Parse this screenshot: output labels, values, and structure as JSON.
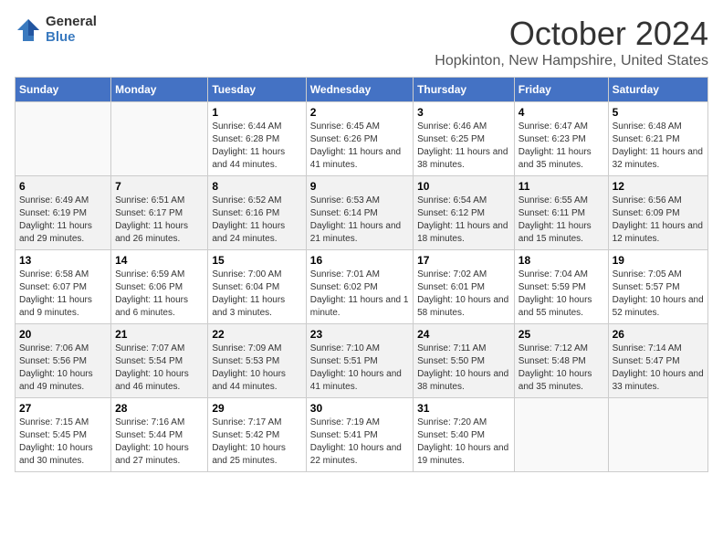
{
  "header": {
    "logo_general": "General",
    "logo_blue": "Blue",
    "month_title": "October 2024",
    "location": "Hopkinton, New Hampshire, United States"
  },
  "weekdays": [
    "Sunday",
    "Monday",
    "Tuesday",
    "Wednesday",
    "Thursday",
    "Friday",
    "Saturday"
  ],
  "weeks": [
    [
      {
        "day": "",
        "empty": true
      },
      {
        "day": "",
        "empty": true
      },
      {
        "day": "1",
        "sunrise": "6:44 AM",
        "sunset": "6:28 PM",
        "daylight": "11 hours and 44 minutes."
      },
      {
        "day": "2",
        "sunrise": "6:45 AM",
        "sunset": "6:26 PM",
        "daylight": "11 hours and 41 minutes."
      },
      {
        "day": "3",
        "sunrise": "6:46 AM",
        "sunset": "6:25 PM",
        "daylight": "11 hours and 38 minutes."
      },
      {
        "day": "4",
        "sunrise": "6:47 AM",
        "sunset": "6:23 PM",
        "daylight": "11 hours and 35 minutes."
      },
      {
        "day": "5",
        "sunrise": "6:48 AM",
        "sunset": "6:21 PM",
        "daylight": "11 hours and 32 minutes."
      }
    ],
    [
      {
        "day": "6",
        "sunrise": "6:49 AM",
        "sunset": "6:19 PM",
        "daylight": "11 hours and 29 minutes."
      },
      {
        "day": "7",
        "sunrise": "6:51 AM",
        "sunset": "6:17 PM",
        "daylight": "11 hours and 26 minutes."
      },
      {
        "day": "8",
        "sunrise": "6:52 AM",
        "sunset": "6:16 PM",
        "daylight": "11 hours and 24 minutes."
      },
      {
        "day": "9",
        "sunrise": "6:53 AM",
        "sunset": "6:14 PM",
        "daylight": "11 hours and 21 minutes."
      },
      {
        "day": "10",
        "sunrise": "6:54 AM",
        "sunset": "6:12 PM",
        "daylight": "11 hours and 18 minutes."
      },
      {
        "day": "11",
        "sunrise": "6:55 AM",
        "sunset": "6:11 PM",
        "daylight": "11 hours and 15 minutes."
      },
      {
        "day": "12",
        "sunrise": "6:56 AM",
        "sunset": "6:09 PM",
        "daylight": "11 hours and 12 minutes."
      }
    ],
    [
      {
        "day": "13",
        "sunrise": "6:58 AM",
        "sunset": "6:07 PM",
        "daylight": "11 hours and 9 minutes."
      },
      {
        "day": "14",
        "sunrise": "6:59 AM",
        "sunset": "6:06 PM",
        "daylight": "11 hours and 6 minutes."
      },
      {
        "day": "15",
        "sunrise": "7:00 AM",
        "sunset": "6:04 PM",
        "daylight": "11 hours and 3 minutes."
      },
      {
        "day": "16",
        "sunrise": "7:01 AM",
        "sunset": "6:02 PM",
        "daylight": "11 hours and 1 minute."
      },
      {
        "day": "17",
        "sunrise": "7:02 AM",
        "sunset": "6:01 PM",
        "daylight": "10 hours and 58 minutes."
      },
      {
        "day": "18",
        "sunrise": "7:04 AM",
        "sunset": "5:59 PM",
        "daylight": "10 hours and 55 minutes."
      },
      {
        "day": "19",
        "sunrise": "7:05 AM",
        "sunset": "5:57 PM",
        "daylight": "10 hours and 52 minutes."
      }
    ],
    [
      {
        "day": "20",
        "sunrise": "7:06 AM",
        "sunset": "5:56 PM",
        "daylight": "10 hours and 49 minutes."
      },
      {
        "day": "21",
        "sunrise": "7:07 AM",
        "sunset": "5:54 PM",
        "daylight": "10 hours and 46 minutes."
      },
      {
        "day": "22",
        "sunrise": "7:09 AM",
        "sunset": "5:53 PM",
        "daylight": "10 hours and 44 minutes."
      },
      {
        "day": "23",
        "sunrise": "7:10 AM",
        "sunset": "5:51 PM",
        "daylight": "10 hours and 41 minutes."
      },
      {
        "day": "24",
        "sunrise": "7:11 AM",
        "sunset": "5:50 PM",
        "daylight": "10 hours and 38 minutes."
      },
      {
        "day": "25",
        "sunrise": "7:12 AM",
        "sunset": "5:48 PM",
        "daylight": "10 hours and 35 minutes."
      },
      {
        "day": "26",
        "sunrise": "7:14 AM",
        "sunset": "5:47 PM",
        "daylight": "10 hours and 33 minutes."
      }
    ],
    [
      {
        "day": "27",
        "sunrise": "7:15 AM",
        "sunset": "5:45 PM",
        "daylight": "10 hours and 30 minutes."
      },
      {
        "day": "28",
        "sunrise": "7:16 AM",
        "sunset": "5:44 PM",
        "daylight": "10 hours and 27 minutes."
      },
      {
        "day": "29",
        "sunrise": "7:17 AM",
        "sunset": "5:42 PM",
        "daylight": "10 hours and 25 minutes."
      },
      {
        "day": "30",
        "sunrise": "7:19 AM",
        "sunset": "5:41 PM",
        "daylight": "10 hours and 22 minutes."
      },
      {
        "day": "31",
        "sunrise": "7:20 AM",
        "sunset": "5:40 PM",
        "daylight": "10 hours and 19 minutes."
      },
      {
        "day": "",
        "empty": true
      },
      {
        "day": "",
        "empty": true
      }
    ]
  ],
  "labels": {
    "sunrise": "Sunrise:",
    "sunset": "Sunset:",
    "daylight": "Daylight:"
  }
}
